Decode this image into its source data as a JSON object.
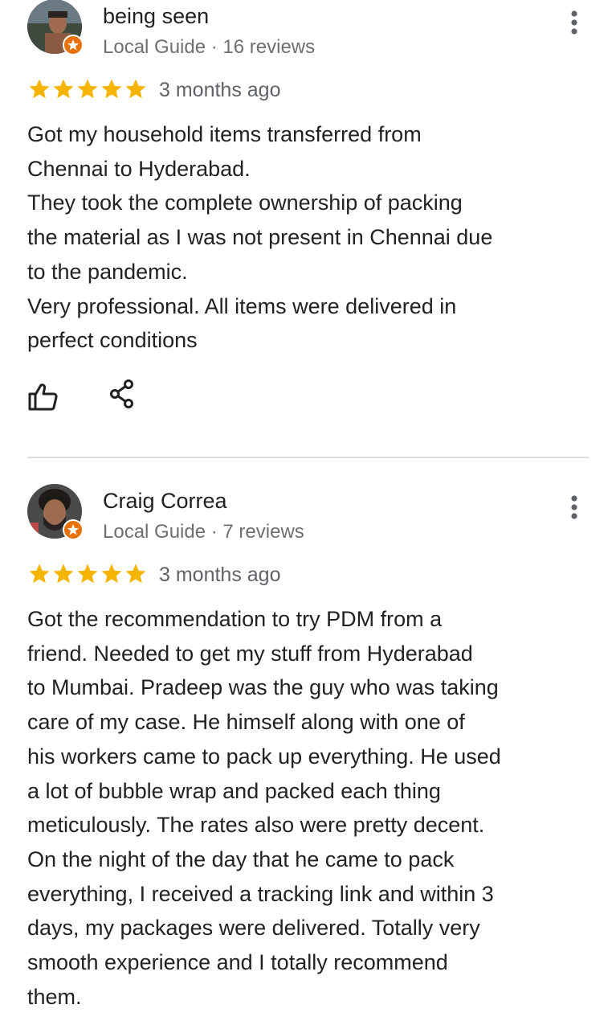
{
  "colors": {
    "star": "#f4b400",
    "local_guide_badge": "#e8710a",
    "meta_text": "#6f6f6f",
    "divider": "#dcdcdc"
  },
  "reviews": [
    {
      "author": "being seen",
      "meta": "Local Guide · 16 reviews",
      "rating": 5,
      "date": "3 months ago",
      "text_lines": [
        "Got my household items transferred from",
        "Chennai to Hyderabad.",
        "They took the complete ownership of packing",
        "the material as I was not present in Chennai due",
        "to the pandemic.",
        "Very professional. All items were delivered in",
        "perfect conditions"
      ],
      "icons": {
        "menu": "more-vert-icon",
        "like": "thumb-up-icon",
        "share": "share-icon",
        "badge": "local-guide-badge-icon"
      }
    },
    {
      "author": "Craig Correa",
      "meta": "Local Guide · 7 reviews",
      "rating": 5,
      "date": "3 months ago",
      "text_lines": [
        "Got the recommendation to try PDM from a",
        "friend. Needed to get my stuff from Hyderabad",
        "to Mumbai. Pradeep was the guy who was taking",
        "care of my case. He himself along with one of",
        "his workers came to pack up everything. He used",
        "a lot of bubble wrap and packed each thing",
        "meticulously. The rates also were pretty decent.",
        "On the night of the day that he came to pack",
        "everything, I received a tracking link and within 3",
        "days, my packages were delivered. Totally very",
        "smooth experience and I totally recommend",
        "them."
      ],
      "icons": {
        "menu": "more-vert-icon",
        "badge": "local-guide-badge-icon"
      }
    }
  ]
}
